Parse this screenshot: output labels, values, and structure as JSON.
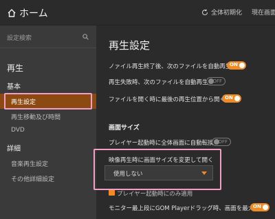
{
  "header": {
    "title": "ホーム",
    "actions": [
      {
        "label": "全体初期化",
        "icon": "refresh-icon"
      },
      {
        "label": "現在画面",
        "icon": "reset-icon"
      }
    ]
  },
  "sidebar": {
    "search_placeholder": "設定検索",
    "section": "再生",
    "groups": [
      {
        "label": "基本",
        "items": [
          {
            "label": "再生設定",
            "active": true
          },
          {
            "label": "再生移動及び時間"
          },
          {
            "label": "DVD"
          }
        ]
      },
      {
        "label": "詳細",
        "items": [
          {
            "label": "音楽再生設定"
          },
          {
            "label": "その他詳細設定"
          }
        ]
      }
    ]
  },
  "main": {
    "title": "再生設定",
    "rows": [
      {
        "label": "ノァイル再生終了後、次のファイルを自動再生",
        "toggle": "ON"
      },
      {
        "label": "再生失敗時、次のファイルを自動再生",
        "toggle": "OFF"
      },
      {
        "label": "ファイルを開く時に最後の再生位置から開く",
        "toggle": "ON"
      }
    ],
    "screen_size_section": "画面サイズ",
    "fullscreen_row": {
      "label": "プレイヤー起動時に全体画面に自動転換",
      "toggle": "OFF"
    },
    "resize_label": "映像再生時に画面サイズを変更して開く",
    "resize_select_value": "使用しない",
    "checkbox_label": "プレイヤー起動時にのみ適用",
    "maximize_row": {
      "label": "モニター最上段にGOM Playerドラッグ時、画面を最大化",
      "toggle": "ON"
    }
  },
  "colors": {
    "accent": "#f08a24",
    "active_item": "#8b4a12",
    "highlight": "#f2a0c8"
  }
}
